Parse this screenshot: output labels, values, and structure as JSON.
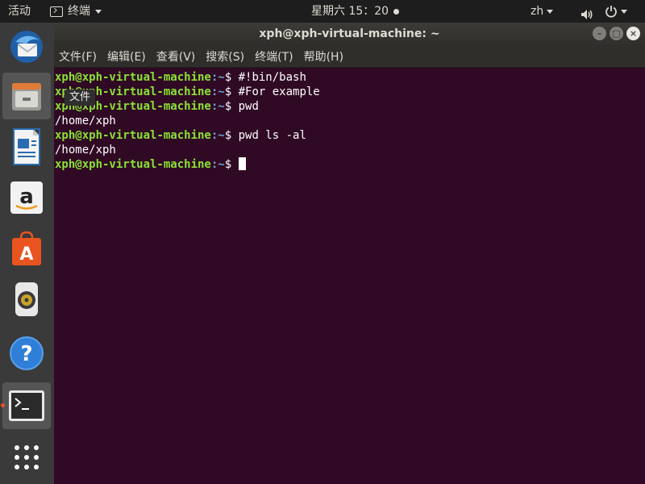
{
  "top_panel": {
    "activities": "活动",
    "app_name": "终端",
    "clock": "星期六 15：20",
    "lang": "zh"
  },
  "dock": {
    "tooltip": "文件",
    "items": [
      {
        "name": "thunderbird-icon"
      },
      {
        "name": "files-icon"
      },
      {
        "name": "libreoffice-writer-icon"
      },
      {
        "name": "amazon-icon"
      },
      {
        "name": "software-center-icon"
      },
      {
        "name": "rhythmbox-icon"
      },
      {
        "name": "help-icon"
      },
      {
        "name": "terminal-icon"
      },
      {
        "name": "show-applications-icon"
      }
    ]
  },
  "window": {
    "title": "xph@xph-virtual-machine: ~",
    "menu": [
      "文件(F)",
      "编辑(E)",
      "查看(V)",
      "搜索(S)",
      "终端(T)",
      "帮助(H)"
    ]
  },
  "terminal": {
    "user_host": "xph@xph-virtual-machine",
    "path": ":~",
    "lines": [
      {
        "prompt": true,
        "cmd": "#!bin/bash"
      },
      {
        "prompt": true,
        "cmd": "#For example"
      },
      {
        "prompt": true,
        "cmd": "pwd"
      },
      {
        "prompt": false,
        "out": "/home/xph"
      },
      {
        "prompt": true,
        "cmd": "pwd ls -al"
      },
      {
        "prompt": false,
        "out": "/home/xph"
      },
      {
        "prompt": true,
        "cmd": ""
      }
    ]
  },
  "colors": {
    "terminal_bg": "#300a24",
    "prompt_user": "#8ae234",
    "prompt_path": "#729fcf",
    "accent": "#e95420"
  }
}
